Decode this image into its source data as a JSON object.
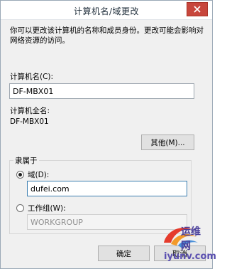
{
  "window": {
    "title": "计算机名/域更改"
  },
  "description": "你可以更改该计算机的名称和成员身份。更改可能会影响对网络资源的访问。",
  "computer_name": {
    "label": "计算机名(C):",
    "value": "DF-MBX01"
  },
  "full_name": {
    "label": "计算机全名:",
    "value": "DF-MBX01"
  },
  "other_button": "其他(M)...",
  "member_of": {
    "legend": "隶属于",
    "domain": {
      "label": "域(D):",
      "value": "dufei.com",
      "checked": true
    },
    "workgroup": {
      "label": "工作组(W):",
      "value": "WORKGROUP",
      "checked": false
    }
  },
  "buttons": {
    "ok": "确定",
    "cancel": "取消"
  },
  "watermark": {
    "text": "运维网",
    "url": "iyunv.com"
  },
  "colors": {
    "close_button": "#c7463c",
    "accent_border": "#3c7fb1"
  },
  "icons": {
    "close": "close-icon"
  }
}
